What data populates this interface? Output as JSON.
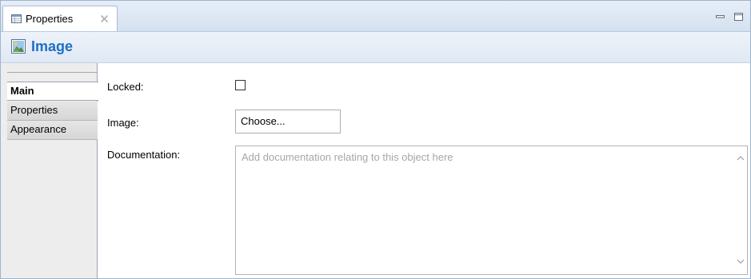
{
  "view_tab": {
    "label": "Properties",
    "icon": "properties-table-icon",
    "close_icon": "close-icon"
  },
  "window_controls": {
    "minimize_icon": "minimize-icon",
    "maximize_icon": "maximize-icon"
  },
  "header": {
    "title": "Image",
    "icon": "image-icon",
    "title_color": "#1f6fc3"
  },
  "sections": [
    {
      "label": "Main",
      "selected": true
    },
    {
      "label": "Properties",
      "selected": false
    },
    {
      "label": "Appearance",
      "selected": false
    }
  ],
  "form": {
    "locked_label": "Locked:",
    "locked_checked": false,
    "image_label": "Image:",
    "choose_button": "Choose...",
    "documentation_label": "Documentation:",
    "documentation_value": "",
    "documentation_placeholder": "Add documentation relating to this object here"
  },
  "colors": {
    "tab_bar": "#dce6f2",
    "side_panel": "#ededed",
    "placeholder_text": "#a6a6a6"
  }
}
